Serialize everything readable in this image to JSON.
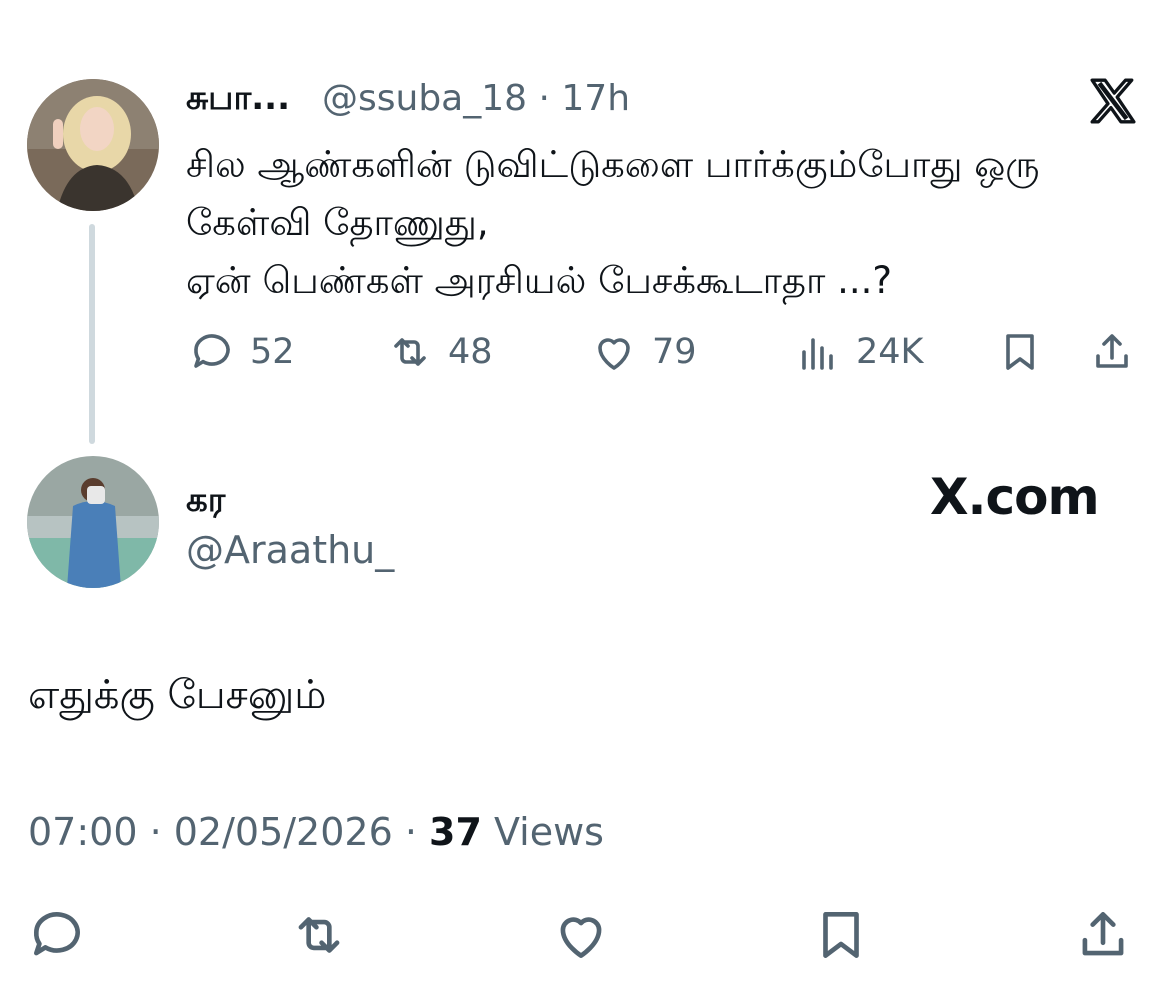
{
  "tweet": {
    "author_name": "சுபா...",
    "handle_time": "@ssuba_18 · 17h",
    "text": "சில ஆண்களின் டுவிட்டுகளை பார்க்கும்போது ஒரு\nகேள்வி தோணுது,\nஏன் பெண்கள் அரசியல் பேசக்கூடாதா ...?",
    "replies": "52",
    "retweets": "48",
    "likes": "79",
    "views": "24K"
  },
  "reply": {
    "author_name": "கர",
    "handle": "@Araathu_",
    "brand": "X.com",
    "text": "எதுக்கு பேசனும்",
    "timestamp": "07:00 · 02/05/2026 · ",
    "view_count": "37",
    "views_label": " Views"
  },
  "icons": [
    "x-logo-icon",
    "reply-icon",
    "retweet-icon",
    "like-icon",
    "views-icon",
    "bookmark-icon",
    "share-icon"
  ],
  "colors": {
    "text": "#0f1419",
    "muted": "#536471",
    "thread_line": "#cfd9de"
  }
}
